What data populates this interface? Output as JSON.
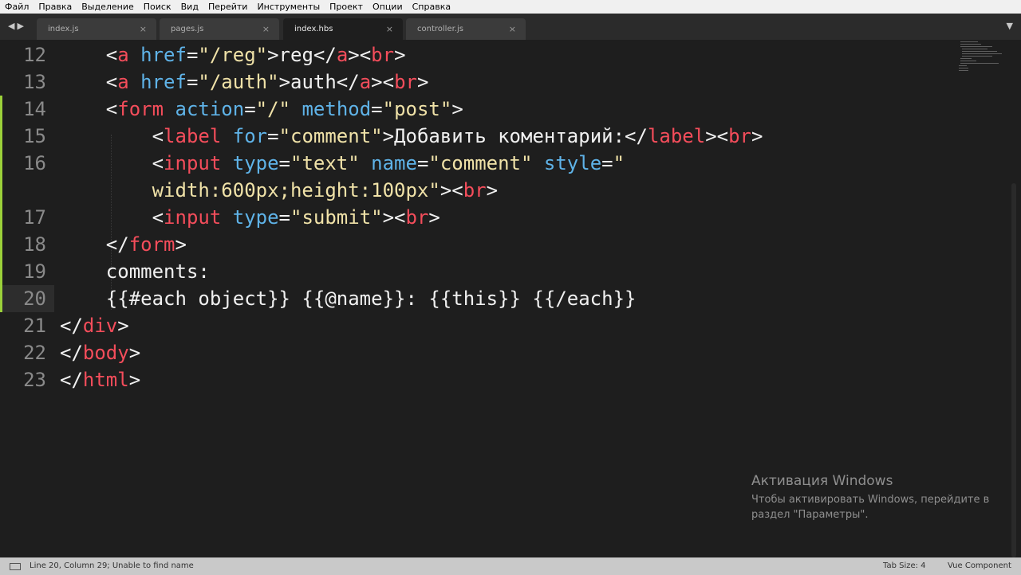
{
  "menu": [
    "Файл",
    "Правка",
    "Выделение",
    "Поиск",
    "Вид",
    "Перейти",
    "Инструменты",
    "Проект",
    "Опции",
    "Справка"
  ],
  "tabs": [
    {
      "label": "index.js",
      "active": false
    },
    {
      "label": "pages.js",
      "active": false
    },
    {
      "label": "index.hbs",
      "active": true
    },
    {
      "label": "controller.js",
      "active": false
    }
  ],
  "editor": {
    "lines": [
      {
        "num": "12",
        "modified": false,
        "current": false,
        "tokens": [
          [
            "",
            "    "
          ],
          [
            "p",
            "<"
          ],
          [
            "t",
            "a"
          ],
          [
            "p",
            " "
          ],
          [
            "a",
            "href"
          ],
          [
            "p",
            "="
          ],
          [
            "s",
            "\"/reg\""
          ],
          [
            "p",
            ">reg</"
          ],
          [
            "t",
            "a"
          ],
          [
            "p",
            "><"
          ],
          [
            "t",
            "br"
          ],
          [
            "p",
            ">"
          ]
        ]
      },
      {
        "num": "13",
        "modified": false,
        "current": false,
        "tokens": [
          [
            "",
            "    "
          ],
          [
            "p",
            "<"
          ],
          [
            "t",
            "a"
          ],
          [
            "p",
            " "
          ],
          [
            "a",
            "href"
          ],
          [
            "p",
            "="
          ],
          [
            "s",
            "\"/auth\""
          ],
          [
            "p",
            ">auth</"
          ],
          [
            "t",
            "a"
          ],
          [
            "p",
            "><"
          ],
          [
            "t",
            "br"
          ],
          [
            "p",
            ">"
          ]
        ]
      },
      {
        "num": "14",
        "modified": true,
        "current": false,
        "tokens": [
          [
            "",
            "    "
          ],
          [
            "p",
            "<"
          ],
          [
            "t",
            "form"
          ],
          [
            "p",
            " "
          ],
          [
            "a",
            "action"
          ],
          [
            "p",
            "="
          ],
          [
            "s",
            "\"/\""
          ],
          [
            "p",
            " "
          ],
          [
            "a",
            "method"
          ],
          [
            "p",
            "="
          ],
          [
            "s",
            "\"post\""
          ],
          [
            "p",
            ">"
          ]
        ]
      },
      {
        "num": "15",
        "modified": true,
        "current": false,
        "tokens": [
          [
            "",
            "        "
          ],
          [
            "p",
            "<"
          ],
          [
            "t",
            "label"
          ],
          [
            "p",
            " "
          ],
          [
            "a",
            "for"
          ],
          [
            "p",
            "="
          ],
          [
            "s",
            "\"comment\""
          ],
          [
            "p",
            ">Добавить коментарий:</"
          ],
          [
            "t",
            "label"
          ],
          [
            "p",
            "><"
          ],
          [
            "t",
            "br"
          ],
          [
            "p",
            ">"
          ]
        ]
      },
      {
        "num": "16",
        "modified": true,
        "current": false,
        "tokens": [
          [
            "",
            "        "
          ],
          [
            "p",
            "<"
          ],
          [
            "t",
            "input"
          ],
          [
            "p",
            " "
          ],
          [
            "a",
            "type"
          ],
          [
            "p",
            "="
          ],
          [
            "s",
            "\"text\""
          ],
          [
            "p",
            " "
          ],
          [
            "a",
            "name"
          ],
          [
            "p",
            "="
          ],
          [
            "s",
            "\"comment\""
          ],
          [
            "p",
            " "
          ],
          [
            "a",
            "style"
          ],
          [
            "p",
            "="
          ],
          [
            "s",
            "\""
          ]
        ]
      },
      {
        "num": "",
        "modified": true,
        "current": false,
        "tokens": [
          [
            "",
            "        "
          ],
          [
            "s",
            "width:600px;height:100px\""
          ],
          [
            "p",
            ">"
          ],
          [
            "p",
            "<"
          ],
          [
            "t",
            "br"
          ],
          [
            "p",
            ">"
          ]
        ]
      },
      {
        "num": "17",
        "modified": true,
        "current": false,
        "tokens": [
          [
            "",
            "        "
          ],
          [
            "p",
            "<"
          ],
          [
            "t",
            "input"
          ],
          [
            "p",
            " "
          ],
          [
            "a",
            "type"
          ],
          [
            "p",
            "="
          ],
          [
            "s",
            "\"submit\""
          ],
          [
            "p",
            "><"
          ],
          [
            "t",
            "br"
          ],
          [
            "p",
            ">"
          ]
        ]
      },
      {
        "num": "18",
        "modified": true,
        "current": false,
        "tokens": [
          [
            "",
            "    "
          ],
          [
            "p",
            "</"
          ],
          [
            "t",
            "form"
          ],
          [
            "p",
            ">"
          ]
        ]
      },
      {
        "num": "19",
        "modified": true,
        "current": false,
        "tokens": [
          [
            "",
            "    "
          ],
          [
            "p",
            "comments:"
          ]
        ]
      },
      {
        "num": "20",
        "modified": true,
        "current": true,
        "tokens": [
          [
            "",
            "    "
          ],
          [
            "p",
            "{{#each object}} {{@name}}: {{this}} {{/each}}"
          ]
        ]
      },
      {
        "num": "21",
        "modified": false,
        "current": false,
        "tokens": [
          [
            "p",
            "</"
          ],
          [
            "t",
            "div"
          ],
          [
            "p",
            ">"
          ]
        ]
      },
      {
        "num": "22",
        "modified": false,
        "current": false,
        "tokens": [
          [
            "p",
            "</"
          ],
          [
            "t",
            "body"
          ],
          [
            "p",
            ">"
          ]
        ]
      },
      {
        "num": "23",
        "modified": false,
        "current": false,
        "tokens": [
          [
            "p",
            "</"
          ],
          [
            "t",
            "html"
          ],
          [
            "p",
            ">"
          ]
        ]
      }
    ]
  },
  "watermark": {
    "title": "Активация Windows",
    "line1": "Чтобы активировать Windows, перейдите в",
    "line2": "раздел \"Параметры\"."
  },
  "status": {
    "position": "Line 20, Column 29; Unable to find name",
    "tab_size": "Tab Size: 4",
    "syntax": "Vue Component"
  },
  "colors": {
    "tag": "#f44d5b",
    "attribute": "#5fb3e8",
    "string": "#f0e2a8",
    "text": "#f0f0f0",
    "modified_marker": "#9bd13a",
    "background": "#1e1e1e"
  },
  "icons": {
    "tab_close": "×",
    "nav_arrows": "◀▶",
    "tab_dropdown": "▼"
  }
}
